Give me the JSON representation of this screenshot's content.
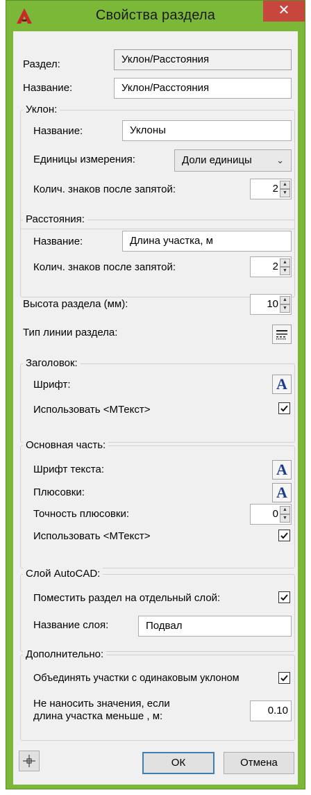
{
  "window": {
    "title": "Свойства раздела",
    "close_glyph": "✕",
    "accent_color": "#7cb838",
    "close_color": "#c7463d"
  },
  "section": {
    "label": "Раздел:",
    "value": "Уклон/Расстояния"
  },
  "name": {
    "label": "Название:",
    "value": "Уклон/Расстояния"
  },
  "slope": {
    "title": "Уклон:",
    "name_label": "Название:",
    "name_value": "Уклоны",
    "units_label": "Единицы измерения:",
    "units_value": "Доли единицы",
    "decimals_label": "Колич. знаков после запятой:",
    "decimals_value": "2"
  },
  "distances": {
    "title": "Расстояния:",
    "name_label": "Название:",
    "name_value": "Длина участка, м",
    "decimals_label": "Колич. знаков после запятой:",
    "decimals_value": "2"
  },
  "height": {
    "label": "Высота раздела (мм):",
    "value": "10"
  },
  "linetype": {
    "label": "Тип линии раздела:",
    "icon": "linetype-icon"
  },
  "header_group": {
    "title": "Заголовок:",
    "font_label": "Шрифт:",
    "font_icon": "A",
    "mtext_label": "Использовать <МТекст>",
    "mtext_checked": true
  },
  "main_group": {
    "title": "Основная часть:",
    "text_font_label": "Шрифт текста:",
    "text_font_icon": "A",
    "plus_label": "Плюсовки:",
    "plus_icon": "A",
    "plus_precision_label": "Точность плюсовки:",
    "plus_precision_value": "0",
    "mtext_label": "Использовать <МТекст>",
    "mtext_checked": true
  },
  "layer_group": {
    "title": "Слой AutoCAD:",
    "separate_label": "Поместить раздел на отдельный слой:",
    "separate_checked": true,
    "layer_name_label": "Название слоя:",
    "layer_name_value": "Подвал"
  },
  "extra_group": {
    "title": "Дополнительно:",
    "merge_label": "Объединять участки с одинаковым уклоном",
    "merge_checked": true,
    "min_label_line1": "Не наносить значения, если",
    "min_label_line2": "длина участка меньше , м:",
    "min_value": "0.10"
  },
  "buttons": {
    "pick_icon": "crosshair-icon",
    "ok": "ОК",
    "cancel": "Отмена"
  }
}
